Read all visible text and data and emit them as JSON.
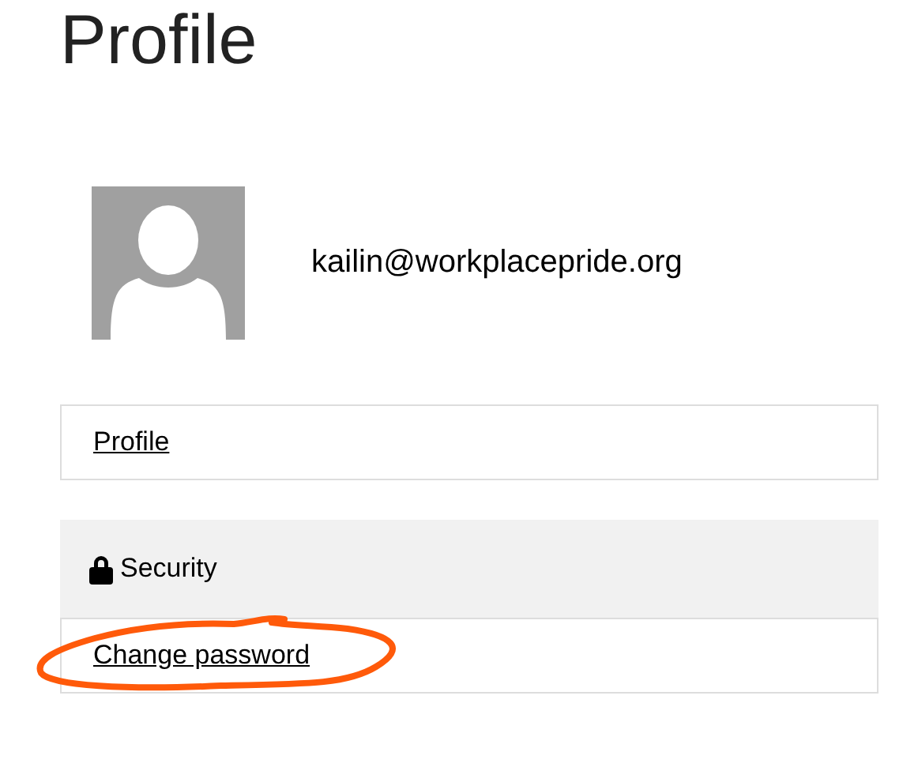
{
  "page_title": "Profile",
  "user": {
    "email": "kailin@workplacepride.org"
  },
  "nav_links": [
    {
      "label": "Profile"
    }
  ],
  "sections": [
    {
      "title": "Security",
      "links": [
        {
          "label": "Change password"
        }
      ]
    }
  ]
}
